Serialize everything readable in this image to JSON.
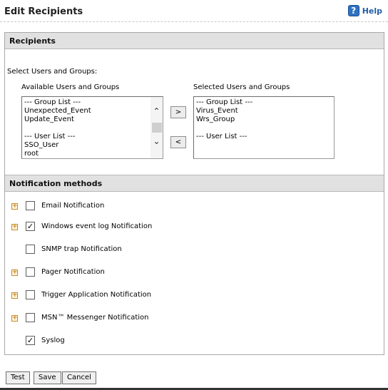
{
  "page": {
    "title": "Edit Recipients",
    "help_label": "Help"
  },
  "recipients": {
    "header": "Recipients",
    "select_label": "Select Users and Groups:",
    "available_label": "Available Users and Groups",
    "selected_label": "Selected Users and Groups",
    "available": [
      "--- Group List ---",
      "Unexpected_Event",
      "Update_Event",
      "",
      "--- User List ---",
      "SSO_User",
      "root"
    ],
    "selected": [
      "--- Group List ---",
      "Virus_Event",
      "Wrs_Group",
      "",
      "--- User List ---"
    ],
    "add_label": ">",
    "remove_label": "<"
  },
  "notification": {
    "header": "Notification methods",
    "methods": [
      {
        "label": "Email Notification",
        "checked": false,
        "expandable": true
      },
      {
        "label": "Windows event log Notification",
        "checked": true,
        "expandable": true
      },
      {
        "label": "SNMP trap Notification",
        "checked": false,
        "expandable": false
      },
      {
        "label": "Pager Notification",
        "checked": false,
        "expandable": true
      },
      {
        "label": "Trigger Application Notification",
        "checked": false,
        "expandable": true
      },
      {
        "label": "MSN™ Messenger Notification",
        "checked": false,
        "expandable": true
      },
      {
        "label": "Syslog",
        "checked": true,
        "expandable": false
      }
    ]
  },
  "buttons": {
    "test": "Test",
    "save": "Save",
    "cancel": "Cancel"
  },
  "icons": {
    "help": "help-icon",
    "expand": "expand-plus-icon",
    "check": "checkmark-icon",
    "scroll_up": "chevron-up-icon",
    "scroll_down": "chevron-down-icon"
  }
}
